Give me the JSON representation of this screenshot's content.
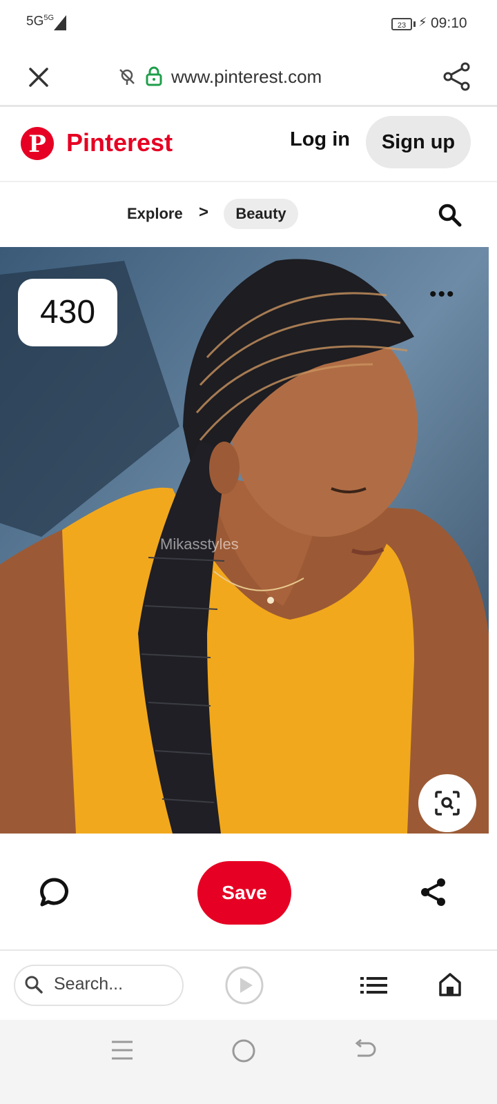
{
  "status_bar": {
    "network": "5G",
    "network_secondary": "5G",
    "battery": "23",
    "time": "09:10"
  },
  "browser": {
    "url": "www.pinterest.com",
    "icons": [
      "close-icon",
      "tracker-blocked-icon",
      "lock-icon",
      "share-icon"
    ]
  },
  "header": {
    "logo_letter": "P",
    "brand": "Pinterest",
    "login_label": "Log in",
    "signup_label": "Sign up",
    "brand_color": "#e60023"
  },
  "breadcrumb": {
    "items": [
      "Explore",
      "Beauty"
    ],
    "separator": ">"
  },
  "pin": {
    "count": "430",
    "watermark": "Mikasstyles",
    "more_icon": "more-horizontal-icon",
    "lens_icon": "visual-search-icon"
  },
  "actions": {
    "save_label": "Save",
    "comment_icon": "comment-icon",
    "share_icon": "share-icon"
  },
  "bottom_bar": {
    "search_placeholder": "Search...",
    "icons": [
      "search-icon",
      "play-icon",
      "list-icon",
      "home-icon"
    ]
  },
  "system_nav": {
    "icons": [
      "menu-icon",
      "home-circle-icon",
      "back-icon"
    ]
  }
}
